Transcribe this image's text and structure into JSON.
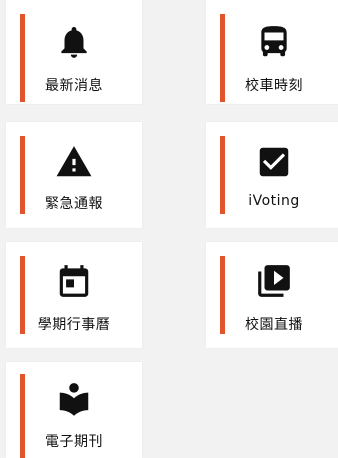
{
  "accent_color": "#e0552b",
  "icon_color": "#111111",
  "tiles": [
    {
      "label": "最新消息",
      "icon": "bell-icon"
    },
    {
      "label": "校車時刻",
      "icon": "bus-icon"
    },
    {
      "label": "緊急通報",
      "icon": "warning-icon"
    },
    {
      "label": "iVoting",
      "icon": "checkbox-icon"
    },
    {
      "label": "學期行事曆",
      "icon": "calendar-icon"
    },
    {
      "label": "校園直播",
      "icon": "video-library-icon"
    },
    {
      "label": "電子期刊",
      "icon": "reading-book-icon"
    }
  ]
}
